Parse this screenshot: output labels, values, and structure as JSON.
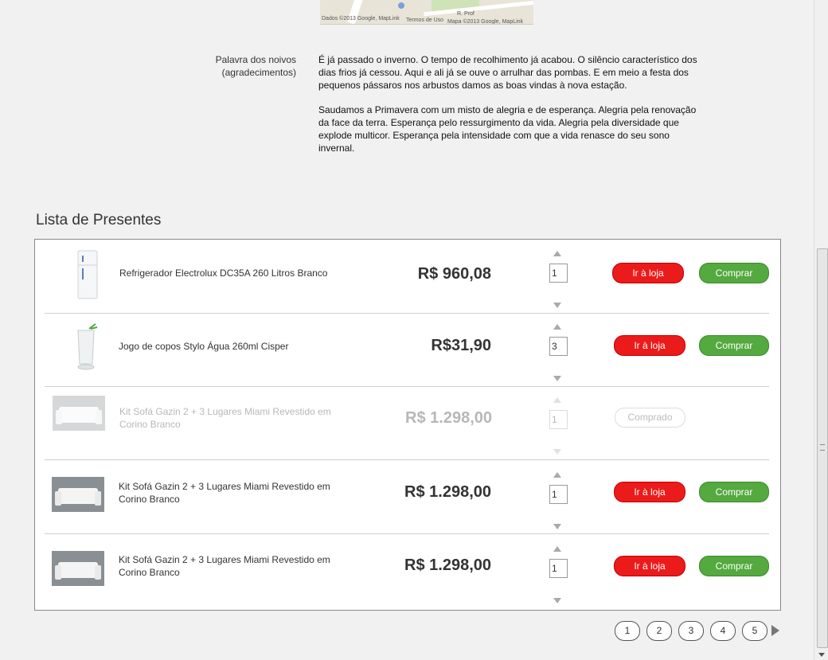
{
  "map": {
    "copyright_left": "Dados ©2013 Google, MapLink",
    "terms": "Termos de Uso",
    "copyright_right": "Mapa ©2013 Google, MapLink",
    "street": "R. Prof"
  },
  "message": {
    "label": "Palavra dos noivos (agradecimentos)",
    "paragraphs": [
      "É já passado o inverno. O tempo de recolhimento já acabou. O silêncio característico dos dias frios já cessou. Aqui e ali já se ouve o arrulhar das pombas. E em meio a festa dos pequenos pássaros nos arbustos damos as boas vindas à nova estação.",
      "Saudamos a Primavera com um misto de alegria e de esperança. Alegria pela renovação da face da terra. Esperança pelo ressurgimento da vida. Alegria pela diversidade que explode multicor. Esperança pela intensidade com que a vida renasce do seu sono invernal."
    ]
  },
  "gifts": {
    "title": "Lista de Presentes",
    "store_label": "Ir à loja",
    "buy_label": "Comprar",
    "bought_label": "Comprado",
    "items": [
      {
        "name": "Refrigerador Electrolux DC35A 260 Litros Branco",
        "price": "R$ 960,08",
        "qty": "1",
        "status": "available",
        "image": "fridge-image"
      },
      {
        "name": "Jogo de copos Stylo Água 260ml Cisper",
        "price": "R$31,90",
        "qty": "3",
        "status": "available",
        "image": "glass-image"
      },
      {
        "name": "Kit Sofá Gazin 2 + 3 Lugares Miami Revestido em Corino Branco",
        "price": "R$ 1.298,00",
        "qty": "1",
        "status": "bought",
        "image": "sofa-image"
      },
      {
        "name": "Kit Sofá Gazin 2 + 3 Lugares Miami Revestido em Corino Branco",
        "price": "R$ 1.298,00",
        "qty": "1",
        "status": "available",
        "image": "sofa-image"
      },
      {
        "name": "Kit Sofá Gazin 2 + 3 Lugares Miami Revestido em Corino Branco",
        "price": "R$ 1.298,00",
        "qty": "1",
        "status": "available",
        "image": "sofa-image"
      }
    ]
  },
  "pagination": {
    "pages": [
      "1",
      "2",
      "3",
      "4",
      "5"
    ],
    "next_icon": "triangle-right-icon"
  },
  "colors": {
    "store_button": "#ec1b1b",
    "buy_button": "#54a93f"
  }
}
